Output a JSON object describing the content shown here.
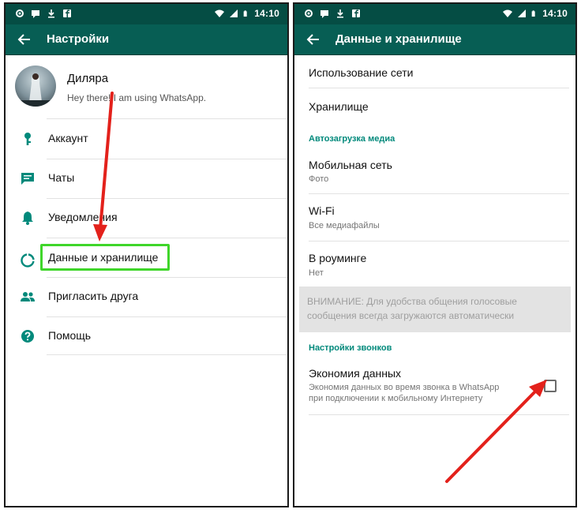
{
  "left_screen": {
    "status_time": "14:10",
    "title": "Настройки",
    "profile": {
      "name": "Диляра",
      "status": "Hey there! I am using WhatsApp."
    },
    "menu": [
      {
        "label": "Аккаунт",
        "icon": "key-icon"
      },
      {
        "label": "Чаты",
        "icon": "chat-icon"
      },
      {
        "label": "Уведомления",
        "icon": "bell-icon"
      },
      {
        "label": "Данные и хранилище",
        "icon": "data-usage-icon",
        "highlighted": true
      },
      {
        "label": "Пригласить друга",
        "icon": "people-icon"
      },
      {
        "label": "Помощь",
        "icon": "help-icon"
      }
    ]
  },
  "right_screen": {
    "status_time": "14:10",
    "title": "Данные и хранилище",
    "network_usage": "Использование сети",
    "storage": "Хранилище",
    "media_section": "Автозагрузка медиа",
    "mobile": {
      "title": "Мобильная сеть",
      "value": "Фото"
    },
    "wifi": {
      "title": "Wi-Fi",
      "value": "Все медиафайлы"
    },
    "roaming": {
      "title": "В роуминге",
      "value": "Нет"
    },
    "warning_line1": "ВНИМАНИЕ: Для удобства общения голосовые",
    "warning_line2": "сообщения всегда загружаются автоматически",
    "calls_section": "Настройки звонков",
    "low_data": {
      "title": "Экономия данных",
      "desc_line1": "Экономия данных во время звонка в WhatsApp",
      "desc_line2": "при подключении к мобильному Интернету",
      "checked": false
    }
  },
  "colors": {
    "statusbar": "#054d44",
    "appbar": "#075e54",
    "icon": "#00897b",
    "section": "#00897b",
    "highlight": "#3fd62a",
    "arrow": "#e3211b"
  }
}
